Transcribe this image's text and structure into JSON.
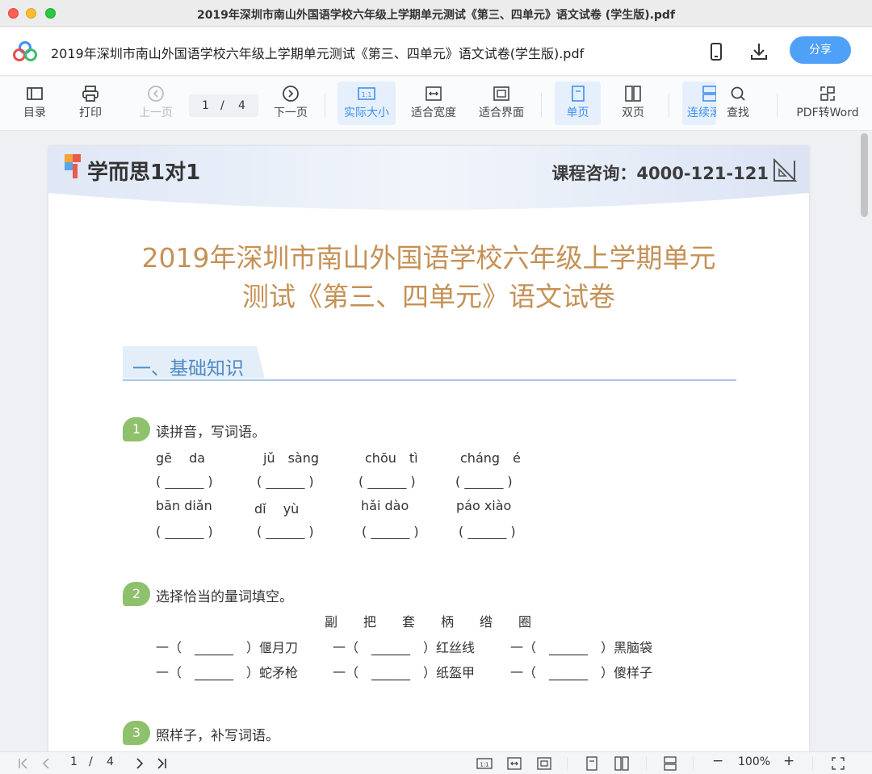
{
  "window": {
    "title": "2019年深圳市南山外国语学校六年级上学期单元测试《第三、四单元》语文试卷 (学生版).pdf"
  },
  "appbar": {
    "doc_title": "2019年深圳市南山外国语学校六年级上学期单元测试《第三、四单元》语文试卷(学生版).pdf",
    "share_label": "分享"
  },
  "toolbar": {
    "toc": "目录",
    "print": "打印",
    "prev": "上一页",
    "page_current": "1",
    "page_sep": "/",
    "page_total": "4",
    "next": "下一页",
    "actual_size": "实际大小",
    "fit_width": "适合宽度",
    "fit_page": "适合界面",
    "single": "单页",
    "double": "双页",
    "continuous": "连续滚",
    "find": "查找",
    "to_word": "PDF转Word",
    "actual_size_glyph": "1:1"
  },
  "page": {
    "brand": "学而思1对1",
    "hotline": "课程咨询：4000-121-121",
    "heading_line1": "2019年深圳市南山外国语学校六年级上学期单元",
    "heading_line2": "测试《第三、四单元》语文试卷",
    "section1": "一、基础知识",
    "q1": {
      "num": "1",
      "text": "读拼音，写词语。",
      "row1": [
        "gē　 da",
        "jǔ　sàng",
        "chōu　tì",
        "cháng　é"
      ],
      "row2": [
        "bān  diǎn",
        "dǐ　 yù",
        "hǎi  dào",
        "páo  xiào"
      ],
      "blank": "( ______ )"
    },
    "q2": {
      "num": "2",
      "text": "选择恰当的量词填空。",
      "options": "副　　把　　套　　柄　　绺　　圈",
      "row1": [
        "一（　______　）偃月刀",
        "一（　______　）红丝线",
        "一（　______　）黑脑袋"
      ],
      "row2": [
        "一（　______　）蛇矛枪",
        "一（　______　）纸盔甲",
        "一（　______　）傻样子"
      ]
    },
    "q3": {
      "num": "3",
      "text": "照样子，补写词语。"
    }
  },
  "statusbar": {
    "page_current": "1",
    "page_sep": "/",
    "page_total": "4",
    "zoom": "100%",
    "zoom_minus": "−",
    "zoom_plus": "+",
    "actual_size_glyph": "1:1"
  },
  "colors": {
    "accent": "#4ea1f7",
    "heading": "#c59156",
    "section": "#4f8ac6",
    "badge": "#8fc16c"
  }
}
